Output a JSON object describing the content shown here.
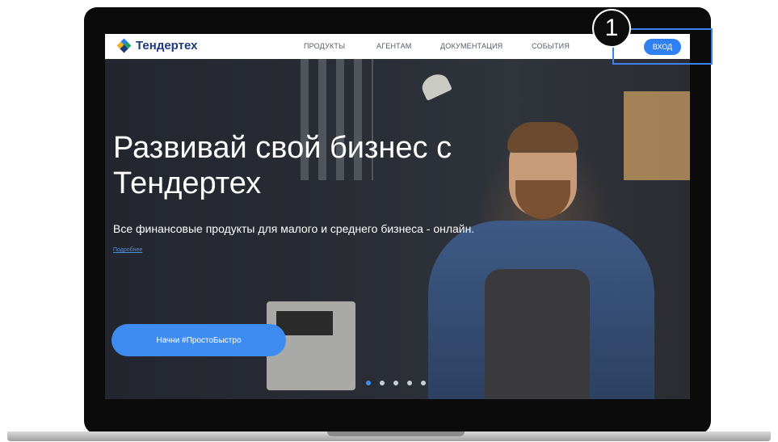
{
  "nav": {
    "logo_text": "Тендертех",
    "links": [
      "ПРОДУКТЫ",
      "АГЕНТАМ",
      "ДОКУМЕНТАЦИЯ",
      "СОБЫТИЯ"
    ],
    "login_label": "ВХОД"
  },
  "hero": {
    "title": "Развивай свой бизнес с Тендертех",
    "subtitle": "Все финансовые продукты для малого и среднего бизнеса - онлайн.",
    "more_link": "Подробнее",
    "cta_label": "Начни #ПростоБыстро",
    "slides_total": 5,
    "active_slide": 1
  },
  "annotation": {
    "step_number": "1"
  },
  "colors": {
    "accent": "#2f80f0",
    "logo": "#1f3a7a",
    "highlight": "#3b82f0"
  },
  "icons": {
    "logo": "diamond-logo-icon"
  }
}
